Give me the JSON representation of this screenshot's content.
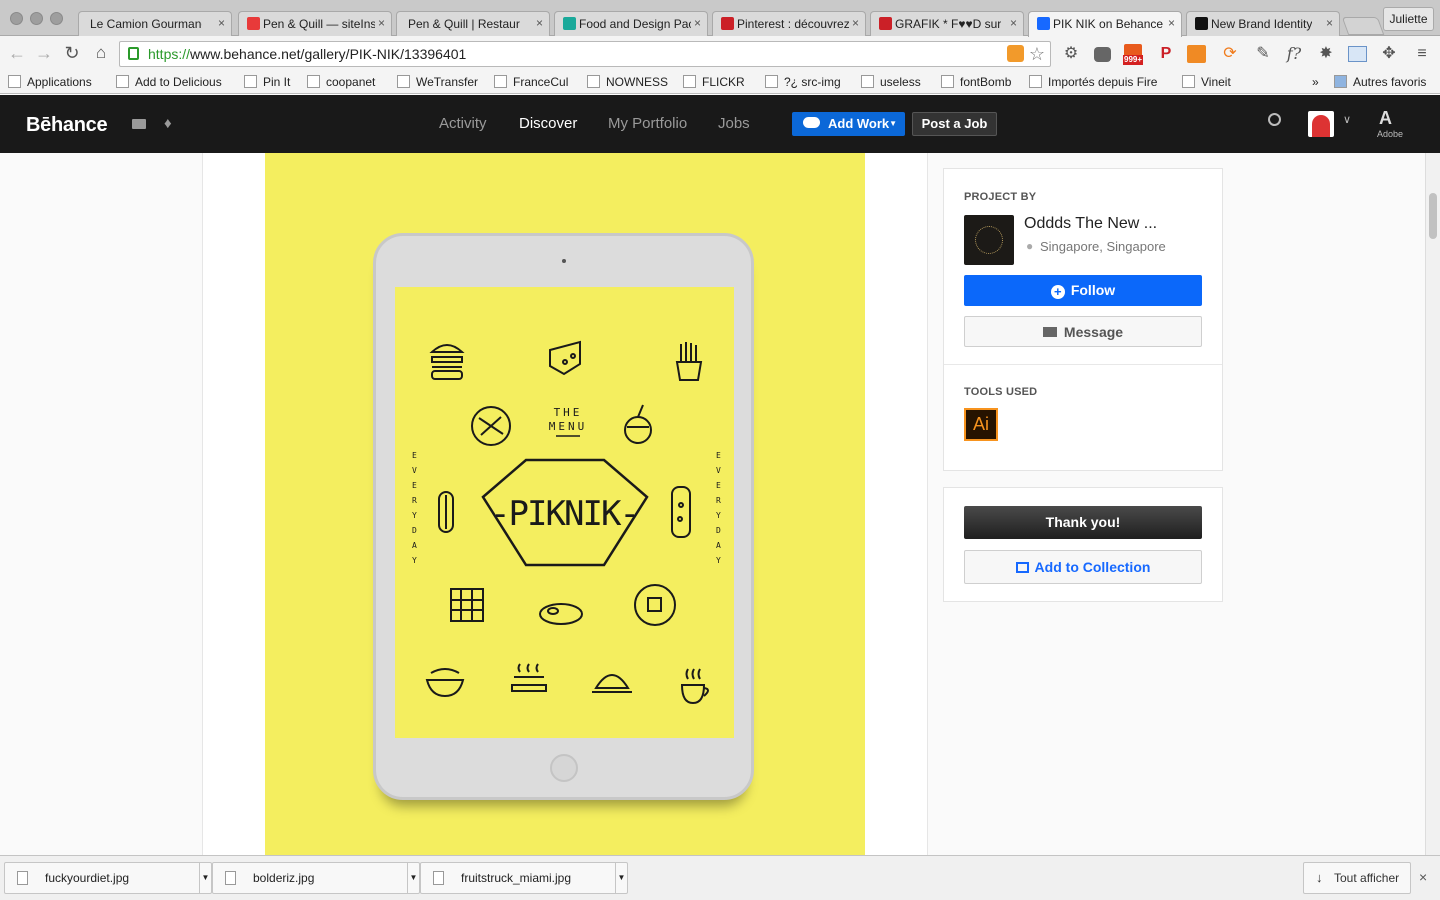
{
  "browser": {
    "tabs": [
      {
        "title": "Le Camion Gourmand",
        "fav_color": ""
      },
      {
        "title": "Pen & Quill — siteInspire",
        "fav_color": "#e83a3a"
      },
      {
        "title": "Pen & Quill | Restaurant",
        "fav_color": ""
      },
      {
        "title": "Food and Design Pack",
        "fav_color": "#1aa99a"
      },
      {
        "title": "Pinterest : découvrez",
        "fav_color": "#cb2027"
      },
      {
        "title": "GRAFIK * F♥♥D sur",
        "fav_color": "#cb2027"
      },
      {
        "title": "PIK NIK on Behance",
        "fav_color": "#1769ff"
      },
      {
        "title": "New Brand Identity",
        "fav_color": "#111111"
      }
    ],
    "active_tab_index": 6,
    "profile_name": "Juliette",
    "url_scheme": "https://",
    "url_rest": "www.behance.net/gallery/PIK-NIK/13396401",
    "bookmarks": [
      "Applications",
      "Add to Delicious",
      "Pin It",
      "coopanet",
      "WeTransfer",
      "FranceCul",
      "NOWNESS",
      "FLICKR",
      "?¿ src-img",
      "useless",
      "fontBomb",
      "Importés depuis Fire",
      "Vineit"
    ],
    "bookmarks_overflow": "»",
    "other_bookmarks": "Autres favoris",
    "ext_badge": "999+"
  },
  "behance": {
    "logo": "Bēhance",
    "nav": [
      "Activity",
      "Discover",
      "My Portfolio",
      "Jobs"
    ],
    "active_nav": "Discover",
    "add_work": "Add Work",
    "post_job": "Post a Job",
    "adobe": "Adobe"
  },
  "project_art": {
    "menu_line1": "THE",
    "menu_line2": "MENU",
    "logo_text": "-PIKNIK-",
    "side_text": "EVERYDAY"
  },
  "sidebar": {
    "project_by_label": "PROJECT BY",
    "owner_name": "Oddds The New ...",
    "owner_location": "Singapore, Singapore",
    "follow_label": "Follow",
    "message_label": "Message",
    "tools_label": "TOOLS USED",
    "tool_name": "Ai",
    "thanks_label": "Thank you!",
    "collection_label": "Add to Collection"
  },
  "downloads": {
    "items": [
      "fuckyourdiet.jpg",
      "bolderiz.jpg",
      "fruitstruck_miami.jpg"
    ],
    "show_all": "Tout afficher"
  },
  "colors": {
    "accent_blue": "#0b68d8",
    "project_yellow": "#f4ee5f",
    "nav_dark": "#191919"
  }
}
